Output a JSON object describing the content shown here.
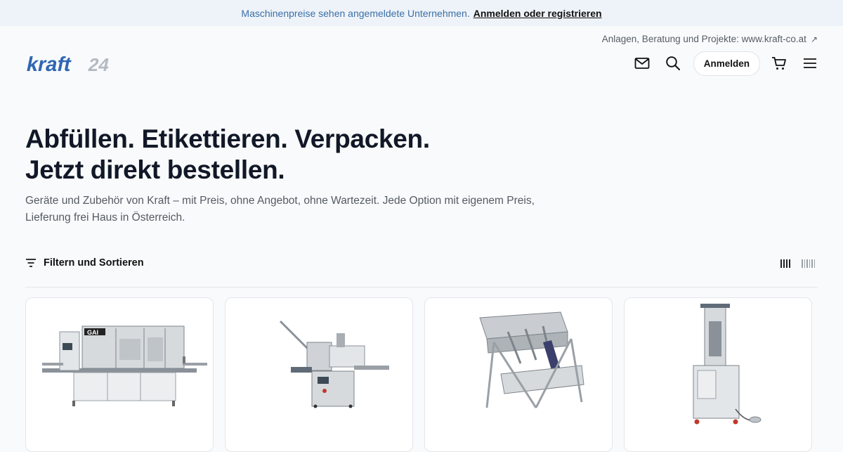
{
  "announcement": {
    "text": "Maschinenpreise sehen angemeldete Unternehmen.",
    "link": "Anmelden oder registrieren"
  },
  "header": {
    "external_link": "Anlagen, Beratung und Projekte: www.kraft-co.at",
    "logo": {
      "part1": "kraft",
      "part2": "24"
    },
    "login_label": "Anmelden",
    "icons": [
      "mail-icon",
      "search-icon",
      "cart-icon",
      "menu-icon"
    ]
  },
  "hero": {
    "title_line1": "Abfüllen. Etikettieren. Verpacken.",
    "title_line2": "Jetzt direkt bestellen.",
    "subtitle": "Geräte und Zubehör von Kraft – mit Preis, ohne Angebot, ohne Wartezeit. Jede Option mit eigenem Preis, Lieferung frei Haus in Österreich."
  },
  "toolbar": {
    "filter_label": "Filtern und Sortieren"
  },
  "products": [
    {
      "image": "rotary-filling-machine",
      "brand_text": "GAI"
    },
    {
      "image": "labeling-machine"
    },
    {
      "image": "manual-bottle-filler"
    },
    {
      "image": "vertical-filling-unit"
    }
  ],
  "colors": {
    "announce_bg": "#eef3f9",
    "announce_text": "#3b6fa6",
    "logo_blue": "#2f66b3",
    "logo_grey": "#b4bac2",
    "page_bg": "#f9fafb"
  }
}
